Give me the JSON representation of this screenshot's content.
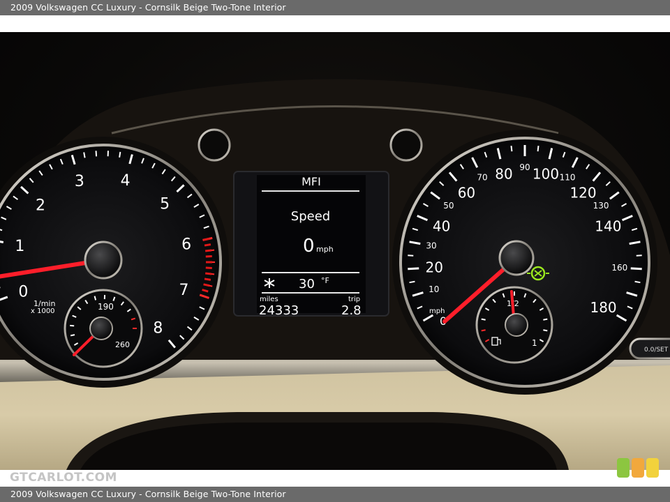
{
  "caption": "2009 Volkswagen CC Luxury - Cornsilk Beige Two-Tone Interior",
  "watermark": "GTCARLOT.COM",
  "colors": {
    "logo_green": "#8cc640",
    "logo_orange": "#f2a83c",
    "logo_yellow": "#f2d23c",
    "needle": "#ff1e2a",
    "indicator_green": "#9be81e"
  },
  "tachometer": {
    "labels": [
      "0",
      "1",
      "2",
      "3",
      "4",
      "5",
      "6",
      "7",
      "8"
    ],
    "unit_line1": "1/min",
    "unit_line2": "x 1000"
  },
  "temp_gauge": {
    "labels": [
      "190",
      "260"
    ]
  },
  "speedometer": {
    "major_labels": [
      "20",
      "40",
      "60",
      "80",
      "100",
      "120",
      "140",
      "180"
    ],
    "minor_labels": [
      "10",
      "30",
      "50",
      "70",
      "90",
      "110",
      "130",
      "160"
    ],
    "unit": "mph",
    "zero_label": "0",
    "indicator_icon": "cruise-control-icon"
  },
  "fuel_gauge": {
    "labels": [
      "1/2",
      "1"
    ],
    "icon": "fuel-pump-icon"
  },
  "mfi": {
    "title": "MFI",
    "mode": "Speed",
    "speed_value": "0",
    "speed_unit": "mph",
    "outside_temp": "30",
    "temp_unit": "°F",
    "temp_icon": "snowflake-icon",
    "odometer_label": "miles",
    "odometer_value": "24333",
    "trip_label": "trip",
    "trip_value": "2.8"
  },
  "button_label": "0.0/SET"
}
